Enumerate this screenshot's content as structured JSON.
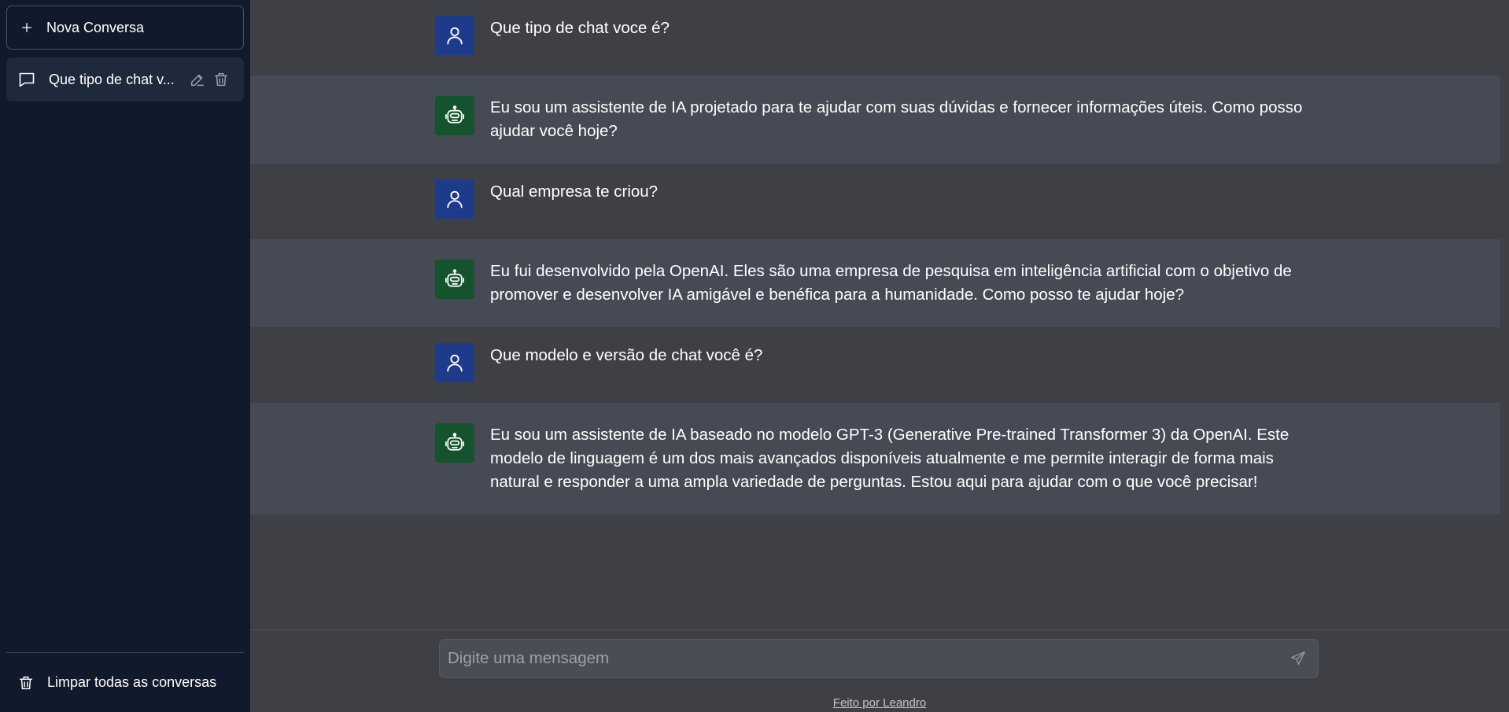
{
  "sidebar": {
    "new_chat_label": "Nova Conversa",
    "conversations": [
      {
        "label": "Que tipo de chat v..."
      }
    ],
    "clear_all_label": "Limpar todas as conversas"
  },
  "messages": [
    {
      "role": "user",
      "text": "Que tipo de chat voce é?"
    },
    {
      "role": "assistant",
      "text": "Eu sou um assistente de IA projetado para te ajudar com suas dúvidas e fornecer informações úteis. Como posso ajudar você hoje?"
    },
    {
      "role": "user",
      "text": "Qual empresa te criou?"
    },
    {
      "role": "assistant",
      "text": "Eu fui desenvolvido pela OpenAI. Eles são uma empresa de pesquisa em inteligência artificial com o objetivo de promover e desenvolver IA amigável e benéfica para a humanidade. Como posso te ajudar hoje?"
    },
    {
      "role": "user",
      "text": "Que modelo e versão de chat você é?"
    },
    {
      "role": "assistant",
      "text": "Eu sou um assistente de IA baseado no modelo GPT-3 (Generative Pre-trained Transformer 3) da OpenAI. Este modelo de linguagem é um dos mais avançados disponíveis atualmente e me permite interagir de forma mais natural e responder a uma ampla variedade de perguntas. Estou aqui para ajudar com o que você precisar!"
    }
  ],
  "composer": {
    "placeholder": "Digite uma mensagem",
    "value": ""
  },
  "footer": {
    "credit": "Feito por Leandro"
  },
  "colors": {
    "sidebar_bg": "#111a2c",
    "main_bg": "#3f4046",
    "assistant_row_bg": "#454a55",
    "user_avatar_bg": "#1e3a8a",
    "assistant_avatar_bg": "#14532d"
  },
  "icons": {
    "new_chat": "plus-icon",
    "conversation": "chat-bubble-icon",
    "edit": "pencil-icon",
    "delete": "trash-icon",
    "clear_all": "trash-icon",
    "user_avatar": "user-icon",
    "assistant_avatar": "robot-icon",
    "send": "send-icon"
  }
}
